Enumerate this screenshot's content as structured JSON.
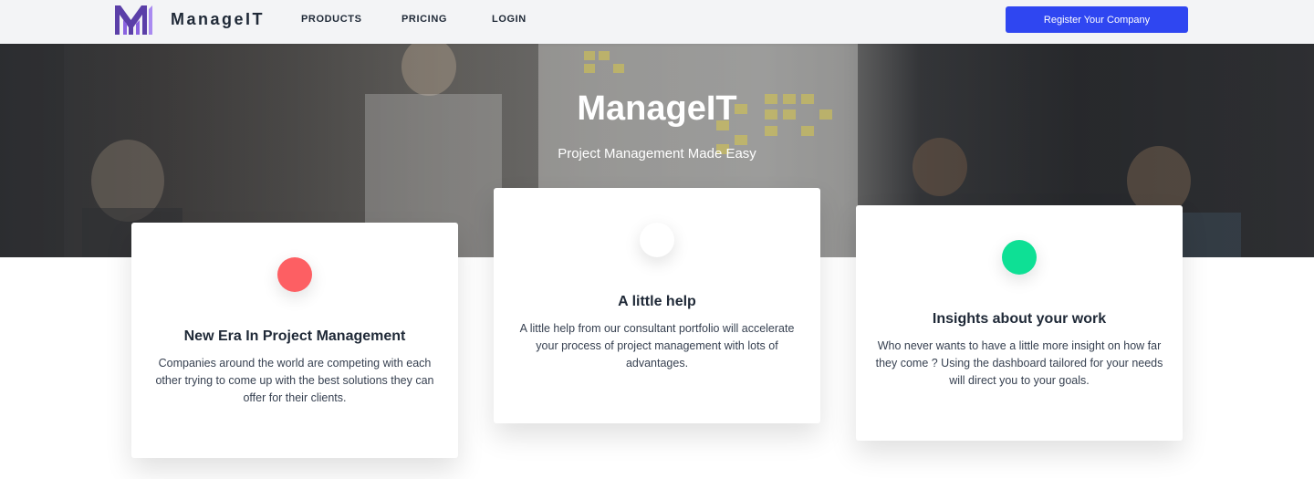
{
  "nav": {
    "brand": "ManageIT",
    "links": [
      "PRODUCTS",
      "PRICING",
      "LOGIN"
    ],
    "register_label": "Register Your Company",
    "register_color": "#2f46f1"
  },
  "hero": {
    "title": "ManageIT",
    "subtitle": "Project Management Made Easy"
  },
  "cards": [
    {
      "title": "New Era In Project Management",
      "text": "Companies around the world are competing with each other trying to come up with the best solutions they can offer for their clients.",
      "dot_color": "#fd5f63"
    },
    {
      "title": "A little help",
      "text": "A little help from our consultant portfolio will accelerate your process of project management with lots of advantages.",
      "dot_color": "#ffffff"
    },
    {
      "title": "Insights about your work",
      "text": "Who never wants to have a little more insight on how far they come ? Using the dashboard tailored for your needs will direct you to your goals.",
      "dot_color": "#0ee095"
    }
  ]
}
